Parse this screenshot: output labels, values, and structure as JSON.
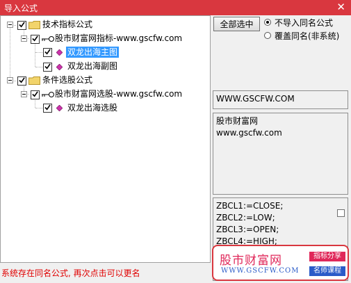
{
  "window": {
    "title": "导入公式",
    "close_glyph": "✕"
  },
  "tree": {
    "groups": [
      {
        "label": "技术指标公式",
        "icon": "folder-icon",
        "checked": true,
        "children": [
          {
            "label": "股市财富网指标-www.gscfw.com",
            "icon": "key-icon",
            "checked": true,
            "items": [
              {
                "label": "双龙出海主图",
                "icon": "diamond-icon",
                "checked": true,
                "selected": true
              },
              {
                "label": "双龙出海副图",
                "icon": "diamond-icon",
                "checked": true,
                "selected": false
              }
            ]
          }
        ]
      },
      {
        "label": "条件选股公式",
        "icon": "folder-icon",
        "checked": true,
        "children": [
          {
            "label": "股市财富网选股-www.gscfw.com",
            "icon": "key-icon",
            "checked": true,
            "items": [
              {
                "label": "双龙出海选股",
                "icon": "diamond-icon",
                "checked": true,
                "selected": false
              }
            ]
          }
        ]
      }
    ]
  },
  "buttons": {
    "select_all": "全部选中"
  },
  "options": {
    "selected": "不导入同名公式",
    "items": [
      "不导入同名公式",
      "覆盖同名(非系统)"
    ]
  },
  "info": {
    "url": "WWW.GSCFW.COM",
    "desc_line1": "股市财富网",
    "desc_line2": "www.gscfw.com"
  },
  "code": {
    "lines": [
      "ZBCL1:=CLOSE;",
      "ZBCL2:=LOW;",
      "ZBCL3:=OPEN;",
      "ZBCL4:=HIGH;"
    ]
  },
  "status": "系统存在同名公式, 再次点击可以更名",
  "watermark": {
    "title": "股市财富网",
    "url": "WWW.GSCFW.COM",
    "tag1": "指标分享",
    "tag2": "名师课程"
  },
  "colors": {
    "titlebar": "#d9373f",
    "selection": "#3399ff",
    "status_text": "#e00000",
    "folder": "#f2d46b",
    "diamond": "#cc33aa"
  }
}
